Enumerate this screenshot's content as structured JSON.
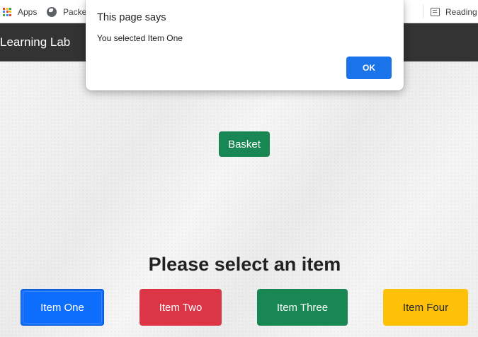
{
  "bookmarks": {
    "apps_label": "Apps",
    "packet_label": "Packet",
    "reading_label": "Reading",
    "apps_colors": [
      "#ea4335",
      "#fbbc04",
      "#34a853",
      "#4285f4",
      "#ea4335",
      "#fbbc04",
      "#34a853",
      "#4285f4",
      "#ea4335"
    ]
  },
  "navbar": {
    "brand": "Learning Lab"
  },
  "main": {
    "basket_label": "Basket",
    "heading": "Please select an item",
    "items": [
      {
        "label": "Item One",
        "color": "#0d6efd"
      },
      {
        "label": "Item Two",
        "color": "#dc3545"
      },
      {
        "label": "Item Three",
        "color": "#198754"
      },
      {
        "label": "Item Four",
        "color": "#ffc107"
      }
    ]
  },
  "dialog": {
    "title": "This page says",
    "message": "You selected Item One",
    "ok_label": "OK",
    "ok_color": "#1a73e8"
  }
}
